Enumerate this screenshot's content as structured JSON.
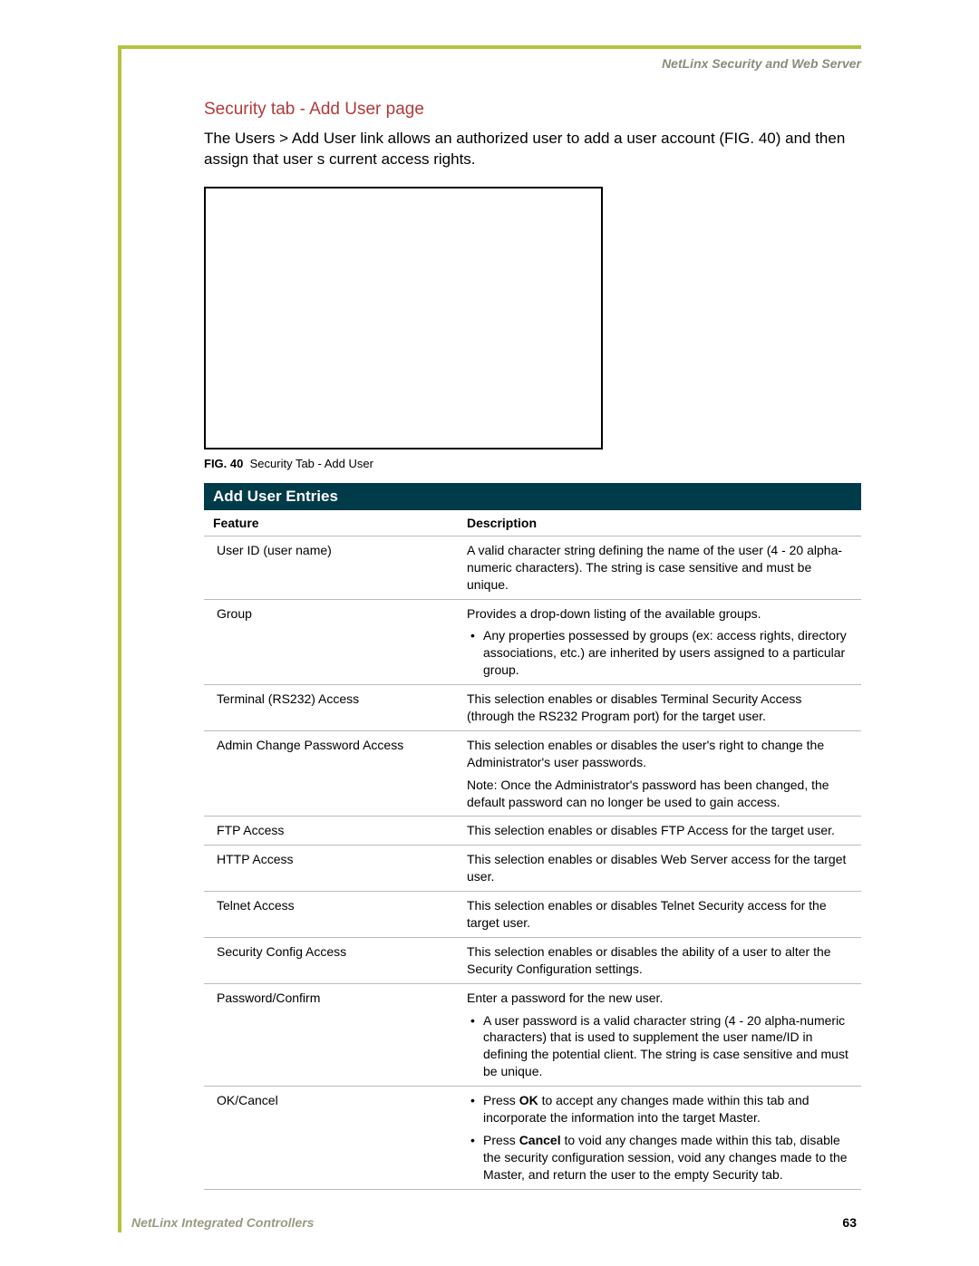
{
  "header": {
    "right": "NetLinx Security and Web Server"
  },
  "section_title": "Security tab - Add User page",
  "intro": "The Users > Add User link allows an authorized user to add a user account (FIG. 40) and then assign that user s current access rights.",
  "figure": {
    "label": "FIG. 40",
    "caption": "Security Tab - Add User"
  },
  "table": {
    "title": "Add User Entries",
    "headers": {
      "feature": "Feature",
      "description": "Description"
    },
    "rows": [
      {
        "feature": "User ID (user name)",
        "desc": "A valid character string defining the name of the user (4 - 20 alpha-numeric characters). The string is case sensitive and must be unique."
      },
      {
        "feature": "Group",
        "desc_lead": "Provides a drop-down listing of the available groups.",
        "bullets": [
          "Any properties possessed by groups (ex: access rights, directory associations, etc.) are inherited by users assigned to a particular group."
        ]
      },
      {
        "feature": "Terminal (RS232) Access",
        "desc": "This selection enables or disables Terminal Security Access (through the RS232 Program port) for the target user."
      },
      {
        "feature": "Admin Change Password Access",
        "desc": "This selection enables or disables the user's right to change the Administrator's user passwords.",
        "note": "Note: Once the Administrator's password has been changed, the default password can no longer be used to gain access."
      },
      {
        "feature": "FTP Access",
        "desc": "This selection enables or disables FTP Access for the target user."
      },
      {
        "feature": "HTTP Access",
        "desc": "This selection enables or disables Web Server access for the target user."
      },
      {
        "feature": "Telnet Access",
        "desc": "This selection enables or disables Telnet Security access for the target user."
      },
      {
        "feature": "Security Config Access",
        "desc": "This selection enables or disables the ability of a user to alter the Security Configuration settings."
      },
      {
        "feature": "Password/Confirm",
        "desc_lead": "Enter a password for the new user.",
        "bullets": [
          "A user password is a valid character string (4 - 20 alpha-numeric characters) that is used to supplement the user name/ID in defining the potential client. The string is case sensitive and must be unique."
        ]
      },
      {
        "feature": "OK/Cancel",
        "rich_bullets": [
          {
            "pre": "Press ",
            "bold": "OK",
            "post": " to accept any changes made within this tab and incorporate the information into the target Master."
          },
          {
            "pre": "Press ",
            "bold": "Cancel",
            "post": " to void any changes made within this tab, disable the security configuration session, void any changes made to the Master, and return the user to the empty Security tab."
          }
        ]
      }
    ]
  },
  "footer": {
    "left": "NetLinx Integrated Controllers",
    "page": "63"
  }
}
